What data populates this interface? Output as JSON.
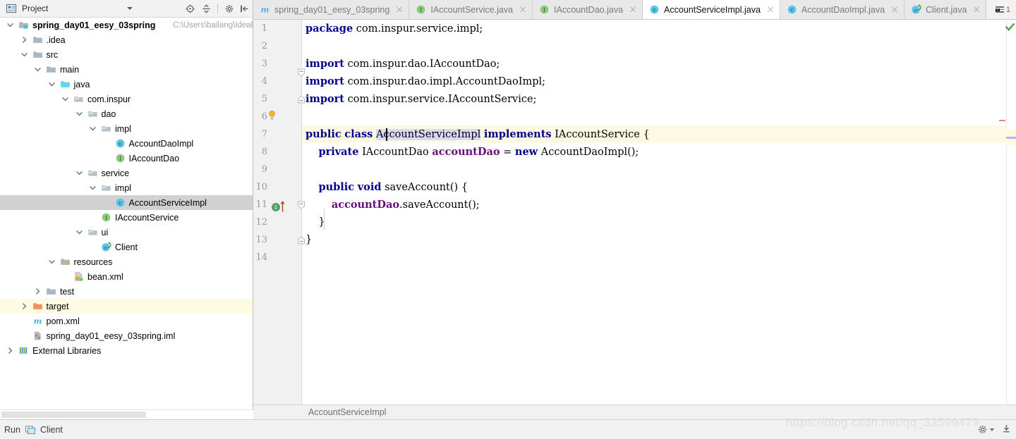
{
  "sidebar": {
    "title": "Project",
    "icons": {
      "panel": "project-panel-icon",
      "dropdown": "chevron-down-icon",
      "locate": "locate-icon",
      "collapse_all": "collapse-all-icon",
      "settings": "gear-icon",
      "hide": "hide-panel-icon"
    },
    "tree": [
      {
        "label": "spring_day01_eesy_03spring",
        "path": "C:\\Users\\bailang\\IdeaPr",
        "depth": 0,
        "icon": "module-folder-icon",
        "twisty": "expanded",
        "bold": true,
        "state": "normal"
      },
      {
        "label": ".idea",
        "depth": 1,
        "icon": "folder-icon",
        "twisty": "collapsed",
        "state": "normal"
      },
      {
        "label": "src",
        "depth": 1,
        "icon": "folder-icon",
        "twisty": "expanded",
        "state": "normal"
      },
      {
        "label": "main",
        "depth": 2,
        "icon": "folder-icon",
        "twisty": "expanded",
        "state": "normal"
      },
      {
        "label": "java",
        "depth": 3,
        "icon": "source-root-icon",
        "twisty": "expanded",
        "state": "normal"
      },
      {
        "label": "com.inspur",
        "depth": 4,
        "icon": "package-icon",
        "twisty": "expanded",
        "state": "normal"
      },
      {
        "label": "dao",
        "depth": 5,
        "icon": "package-icon",
        "twisty": "expanded",
        "state": "normal"
      },
      {
        "label": "impl",
        "depth": 6,
        "icon": "package-icon",
        "twisty": "expanded",
        "state": "normal"
      },
      {
        "label": "AccountDaoImpl",
        "depth": 7,
        "icon": "class-icon",
        "twisty": "none",
        "state": "normal"
      },
      {
        "label": "IAccountDao",
        "depth": 7,
        "icon": "interface-icon",
        "twisty": "none",
        "state": "normal"
      },
      {
        "label": "service",
        "depth": 5,
        "icon": "package-icon",
        "twisty": "expanded",
        "state": "normal"
      },
      {
        "label": "impl",
        "depth": 6,
        "icon": "package-icon",
        "twisty": "expanded",
        "state": "normal"
      },
      {
        "label": "AccountServiceImpl",
        "depth": 7,
        "icon": "class-icon",
        "twisty": "none",
        "state": "selected"
      },
      {
        "label": "IAccountService",
        "depth": 6,
        "icon": "interface-icon",
        "twisty": "none",
        "state": "normal"
      },
      {
        "label": "ui",
        "depth": 5,
        "icon": "package-icon",
        "twisty": "expanded",
        "state": "normal"
      },
      {
        "label": "Client",
        "depth": 6,
        "icon": "runnable-class-icon",
        "twisty": "none",
        "state": "normal"
      },
      {
        "label": "resources",
        "depth": 3,
        "icon": "resources-root-icon",
        "twisty": "expanded",
        "state": "normal"
      },
      {
        "label": "bean.xml",
        "depth": 4,
        "icon": "xml-spring-file-icon",
        "twisty": "none",
        "state": "normal"
      },
      {
        "label": "test",
        "depth": 2,
        "icon": "folder-icon",
        "twisty": "collapsed",
        "state": "normal"
      },
      {
        "label": "target",
        "depth": 1,
        "icon": "excluded-folder-icon",
        "twisty": "collapsed",
        "state": "highlighted"
      },
      {
        "label": "pom.xml",
        "depth": 1,
        "icon": "maven-file-icon",
        "twisty": "none",
        "state": "normal"
      },
      {
        "label": "spring_day01_eesy_03spring.iml",
        "depth": 1,
        "icon": "iml-file-icon",
        "twisty": "none",
        "state": "normal"
      },
      {
        "label": "External Libraries",
        "depth": 0,
        "icon": "libraries-icon",
        "twisty": "collapsed",
        "state": "normal"
      }
    ]
  },
  "tabs": {
    "items": [
      {
        "label": "spring_day01_eesy_03spring",
        "icon": "maven-file-icon",
        "active": false
      },
      {
        "label": "IAccountService.java",
        "icon": "interface-icon",
        "active": false
      },
      {
        "label": "IAccountDao.java",
        "icon": "interface-icon",
        "active": false
      },
      {
        "label": "AccountServiceImpl.java",
        "icon": "class-icon",
        "active": true
      },
      {
        "label": "AccountDaoImpl.java",
        "icon": "class-icon",
        "active": false
      },
      {
        "label": "Client.java",
        "icon": "runnable-class-icon",
        "active": false
      }
    ],
    "overflow_count": "1",
    "overflow_icon": "tab-list-icon"
  },
  "editor": {
    "line_numbers": [
      "1",
      "2",
      "3",
      "4",
      "5",
      "6",
      "7",
      "8",
      "9",
      "10",
      "11",
      "12",
      "13",
      "14"
    ],
    "current_line": "7",
    "selection_text": "AccountServiceImpl",
    "lines": [
      {
        "n": 1,
        "text": "package com.inspur.service.impl;"
      },
      {
        "n": 2,
        "text": ""
      },
      {
        "n": 3,
        "text": "import com.inspur.dao.IAccountDao;"
      },
      {
        "n": 4,
        "text": "import com.inspur.dao.impl.AccountDaoImpl;"
      },
      {
        "n": 5,
        "text": "import com.inspur.service.IAccountService;"
      },
      {
        "n": 6,
        "text": ""
      },
      {
        "n": 7,
        "text": "public class AccountServiceImpl implements IAccountService {"
      },
      {
        "n": 8,
        "text": "    private IAccountDao accountDao = new AccountDaoImpl();"
      },
      {
        "n": 9,
        "text": ""
      },
      {
        "n": 10,
        "text": "    public void saveAccount() {"
      },
      {
        "n": 11,
        "text": "        accountDao.saveAccount();"
      },
      {
        "n": 12,
        "text": "    }"
      },
      {
        "n": 13,
        "text": "}"
      },
      {
        "n": 14,
        "text": ""
      }
    ],
    "gutter_icons": {
      "intention_bulb_line": "6",
      "implemented_method_line": "10",
      "overriding_arrow_line": "10"
    },
    "inspection_status_icon": "ok-checkmark-icon"
  },
  "breadcrumb": {
    "text": "AccountServiceImpl"
  },
  "statusbar": {
    "run_label": "Run",
    "run_config": "Client",
    "run_icon": "run-window-icon",
    "gear_icon": "gear-icon",
    "event_icon": "event-log-icon",
    "watermark": "https://blog.csdn.net/qq_32599479"
  },
  "colors": {
    "keyword": "#00008c",
    "field": "#660e7a",
    "selection": "#d9d9f5",
    "current_line": "#fdf9e2",
    "tree_selected": "#d1d1d1",
    "tree_highlight": "#fdfbe2",
    "gutter_bg": "#f1f1f1"
  }
}
